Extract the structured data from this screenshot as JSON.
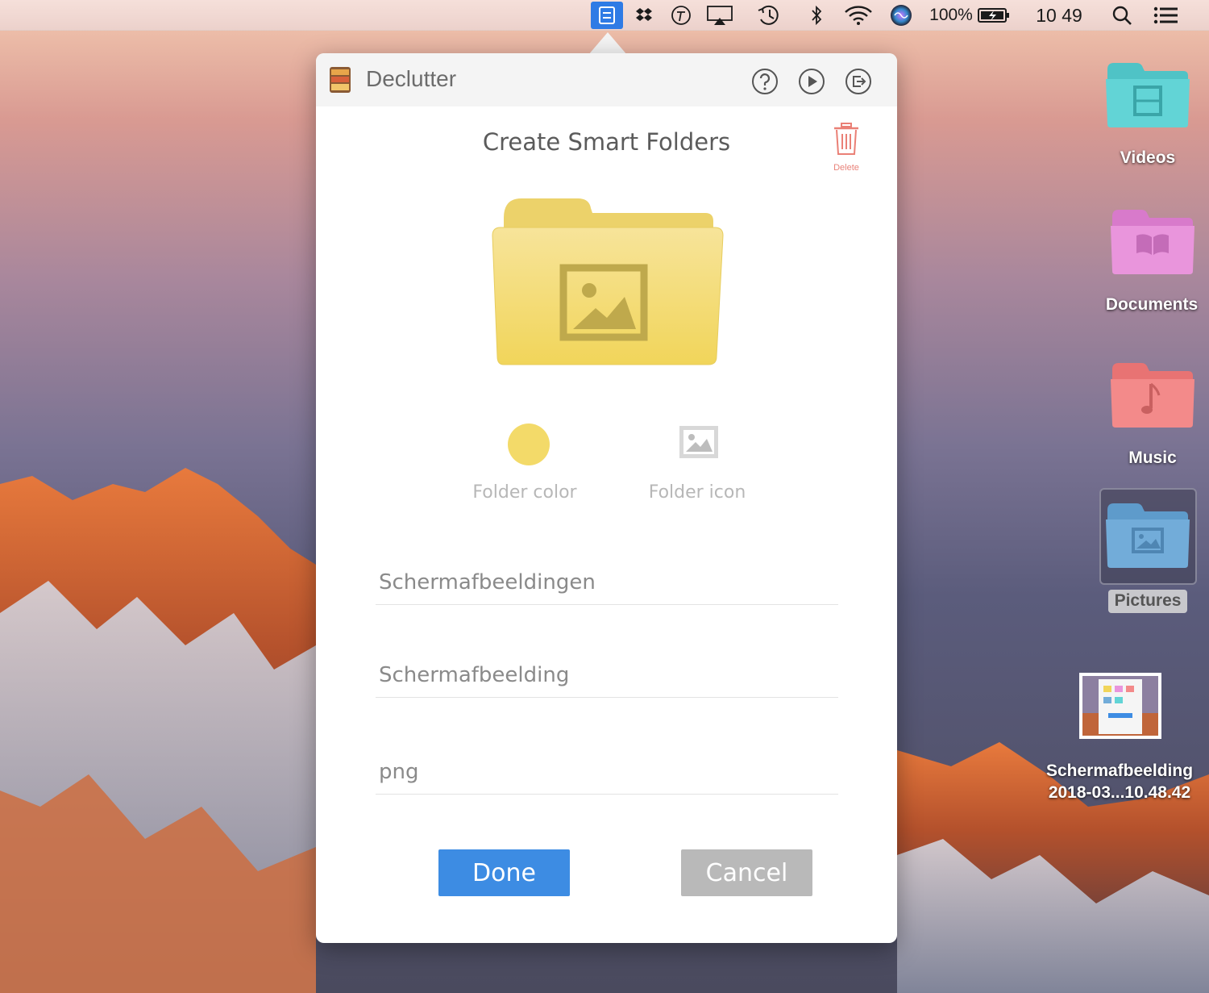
{
  "menubar": {
    "battery_percent": "100%",
    "clock": "10 49",
    "icons": [
      "declutter-icon",
      "dropbox-icon",
      "typeeto-icon",
      "airplay-icon",
      "time-machine-icon",
      "bluetooth-icon",
      "wifi-icon",
      "siri-icon",
      "battery-icon",
      "spotlight-icon",
      "notification-center-icon"
    ]
  },
  "popover": {
    "app_name": "Declutter",
    "header_buttons": [
      "help-icon",
      "play-icon",
      "logout-icon"
    ],
    "title": "Create Smart Folders",
    "delete_label": "Delete",
    "folder_color": "#f3da69",
    "folder_color_label": "Folder color",
    "folder_icon_label": "Folder icon",
    "fields": {
      "folder_name": "Schermafbeeldingen",
      "keyword": "Schermafbeelding",
      "extension": "png"
    },
    "done_label": "Done",
    "cancel_label": "Cancel",
    "accent_color": "#3d8ce3"
  },
  "desktop": {
    "items": [
      {
        "label": "Videos",
        "color": "#5fd0d2",
        "icon": "film-icon"
      },
      {
        "label": "Documents",
        "color": "#e58fd9",
        "icon": "book-icon"
      },
      {
        "label": "Music",
        "color": "#f08383",
        "icon": "music-note-icon"
      },
      {
        "label": "Pictures",
        "color": "#6ea9d6",
        "icon": "image-icon"
      }
    ],
    "screenshot_file": {
      "line1": "Schermafbeelding",
      "line2": "2018-03...10.48.42"
    }
  }
}
